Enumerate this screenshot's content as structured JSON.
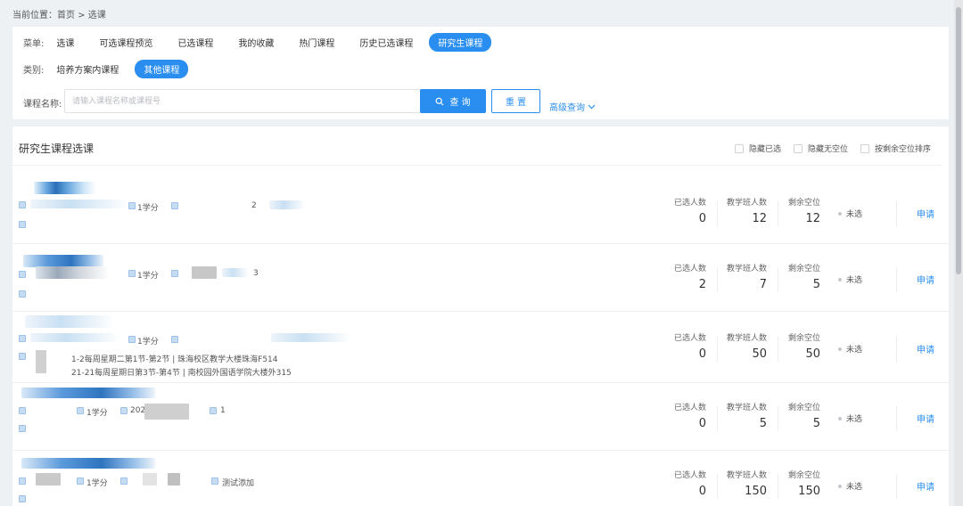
{
  "breadcrumb": "当前位置：首页 > 选课",
  "menu": {
    "label": "菜单:",
    "items": [
      "选课",
      "可选课程预览",
      "已选课程",
      "我的收藏",
      "热门课程",
      "历史已选课程",
      "研究生课程"
    ],
    "active_index": 6
  },
  "category": {
    "label": "类别:",
    "items": [
      "培养方案内课程",
      "其他课程"
    ],
    "active_index": 1
  },
  "search": {
    "label": "课程名称:",
    "placeholder": "请输入课程名称或课程号",
    "query_button": "查 询",
    "reset_button": "重 置",
    "advanced_link": "高级查询"
  },
  "main": {
    "title": "研究生课程选课",
    "options": [
      "隐藏已选",
      "隐藏无空位",
      "按剩余空位排序"
    ]
  },
  "stat_labels": [
    "已选人数",
    "教学班人数",
    "剩余空位"
  ],
  "courses": [
    {
      "meta_credit": "1学分",
      "meta_extra": "2",
      "schedule": [],
      "selected": "0",
      "capacity": "12",
      "remaining": "12",
      "status": "未选",
      "action": "申请"
    },
    {
      "meta_credit": "1学分",
      "meta_extra": "3",
      "schedule": [],
      "selected": "2",
      "capacity": "7",
      "remaining": "5",
      "status": "未选",
      "action": "申请"
    },
    {
      "meta_credit": "1学分",
      "meta_extra": "",
      "schedule": [
        "1-2每周星期二第1节-第2节 | 珠海校区教学大楼珠海F514",
        "21-21每周星期日第3节-第4节 | 南校园外国语学院大楼外315"
      ],
      "selected": "0",
      "capacity": "50",
      "remaining": "50",
      "status": "未选",
      "action": "申请"
    },
    {
      "meta_credit": "1学分",
      "meta_year": "202",
      "meta_extra": "1",
      "schedule": [],
      "selected": "0",
      "capacity": "5",
      "remaining": "5",
      "status": "未选",
      "action": "申请"
    },
    {
      "meta_credit": "1学分",
      "meta_extra": "测试添加",
      "schedule": [],
      "selected": "0",
      "capacity": "150",
      "remaining": "150",
      "status": "未选",
      "action": "申请"
    }
  ]
}
